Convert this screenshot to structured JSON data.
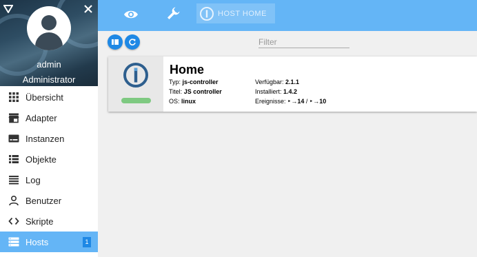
{
  "sidebar": {
    "user_name": "admin",
    "user_role": "Administrator",
    "items": [
      {
        "label": "Übersicht",
        "icon": "grid-icon"
      },
      {
        "label": "Adapter",
        "icon": "store-icon"
      },
      {
        "label": "Instanzen",
        "icon": "instances-icon"
      },
      {
        "label": "Objekte",
        "icon": "list-icon"
      },
      {
        "label": "Log",
        "icon": "log-icon"
      },
      {
        "label": "Benutzer",
        "icon": "user-icon"
      },
      {
        "label": "Skripte",
        "icon": "code-icon"
      },
      {
        "label": "Hosts",
        "icon": "hosts-icon",
        "badge": "1",
        "active": true
      }
    ]
  },
  "topbar": {
    "tab_label": "HOST HOME"
  },
  "toolbar": {
    "filter_placeholder": "Filter"
  },
  "host": {
    "name": "Home",
    "typ_label": "Typ:",
    "typ_value": "js-controller",
    "titel_label": "Titel:",
    "titel_value": "JS controller",
    "os_label": "OS:",
    "os_value": "linux",
    "available_label": "Verfügbar:",
    "available_value": "2.1.1",
    "installed_label": "Installiert:",
    "installed_value": "1.4.2",
    "events_label": "Ereignisse:",
    "events_in": "14",
    "events_sep": "/",
    "events_out": "10"
  },
  "colors": {
    "accent": "#64b5f6",
    "button": "#1e88e5",
    "status_ok": "#7ec981",
    "logo": "#2e5f8e"
  }
}
